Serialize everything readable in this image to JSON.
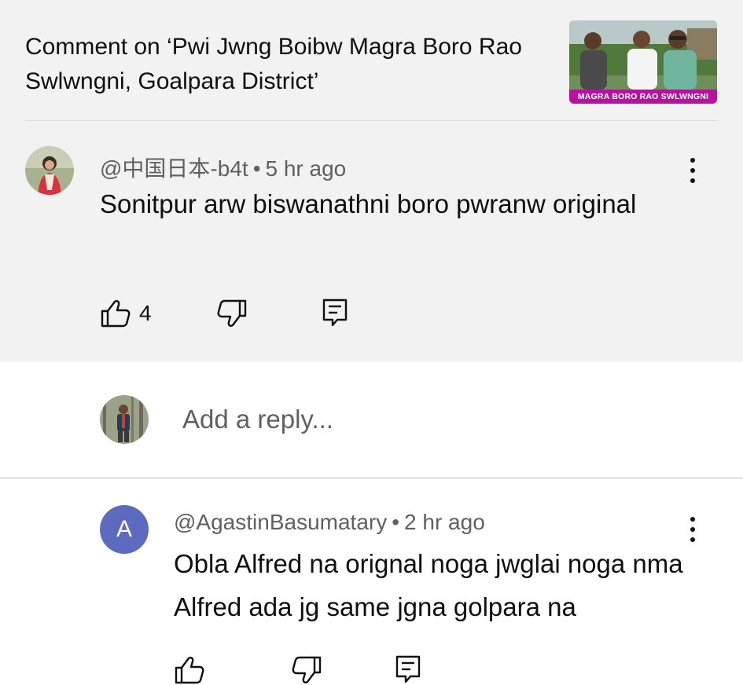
{
  "context": {
    "title": "Comment on ‘Pwi Jwng Boibw Magra Boro Rao Swlwngni, Goalpara District’",
    "thumbnail_caption": "MAGRA BORO RAO SWLWNGNI",
    "thumbnail_accent": "#b8119f"
  },
  "comment": {
    "author": "@中国日本-b4t",
    "separator": "•",
    "time": "5 hr ago",
    "text": "Sonitpur arw biswanathni boro pwranw original",
    "like_count": "4",
    "icons": [
      "more-vertical-icon",
      "thumbs-up-icon",
      "thumbs-down-icon",
      "comment-icon"
    ]
  },
  "reply_box": {
    "placeholder": "Add a reply..."
  },
  "reply": {
    "avatar_letter": "A",
    "avatar_color": "#5c6bc0",
    "author": "@AgastinBasumatary",
    "separator": "•",
    "time": "2 hr ago",
    "text": "Obla Alfred na orignal noga jwglai noga nma Alfred ada jg same jgna golpara na"
  }
}
